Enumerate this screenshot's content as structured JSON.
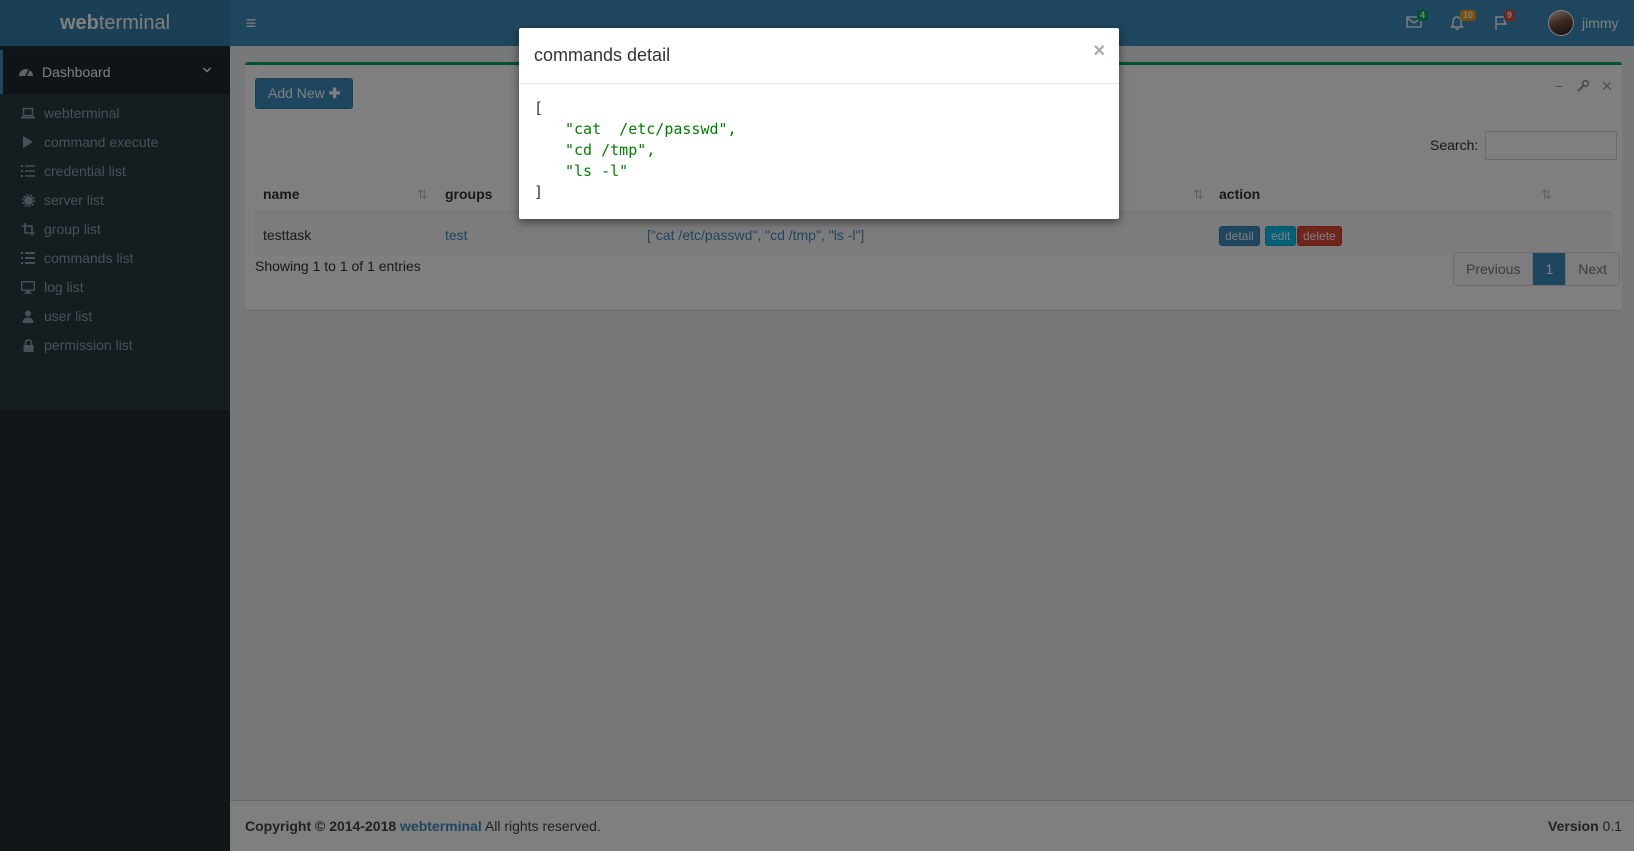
{
  "header": {
    "logo_bold": "web",
    "logo_rest": "terminal",
    "hamburger": "≡",
    "mail_badge": "4",
    "bell_badge": "10",
    "flag_badge": "9",
    "user_name": "jimmy"
  },
  "sidebar": {
    "dashboard": "Dashboard",
    "items": [
      {
        "label": "webterminal",
        "icon": "laptop-icon"
      },
      {
        "label": "command execute",
        "icon": "play-icon"
      },
      {
        "label": "credential list",
        "icon": "list-ol-icon"
      },
      {
        "label": "server list",
        "icon": "gear-icon"
      },
      {
        "label": "group list",
        "icon": "crop-icon"
      },
      {
        "label": "commands list",
        "icon": "list-icon"
      },
      {
        "label": "log list",
        "icon": "desktop-icon"
      },
      {
        "label": "user list",
        "icon": "user-icon"
      },
      {
        "label": "permission list",
        "icon": "lock-icon"
      }
    ]
  },
  "box": {
    "add_new": "Add New",
    "search_label": "Search:",
    "search_value": ""
  },
  "table": {
    "headers": {
      "name": "name",
      "groups": "groups",
      "action": "action"
    },
    "rows": [
      {
        "name": "testtask",
        "groups": "test",
        "commands": "[\"cat /etc/passwd\", \"cd /tmp\", \"ls -l\"]",
        "detail": "detail",
        "edit": "edit",
        "delete": "delete"
      }
    ],
    "showing": "Showing 1 to 1 of 1 entries"
  },
  "pagination": {
    "previous": "Previous",
    "page": "1",
    "next": "Next"
  },
  "footer": {
    "copyright_prefix": "Copyright © 2014-2018",
    "brand": "webterminal",
    "rights": "All rights reserved.",
    "version_label": "Version",
    "version": "0.1"
  },
  "modal": {
    "title": "commands detail",
    "close": "×",
    "open_bracket": "[",
    "lines": [
      "\"cat  /etc/passwd\",",
      "\"cd /tmp\",",
      "\"ls -l\""
    ],
    "close_bracket": "]"
  },
  "colors": {
    "header": "#3c8dbc",
    "logo_bg": "#367fa9",
    "sidebar": "#222d32",
    "box_border": "#00a65a",
    "code_string": "#008000",
    "delete": "#dd4b39",
    "edit": "#00c0ef"
  }
}
